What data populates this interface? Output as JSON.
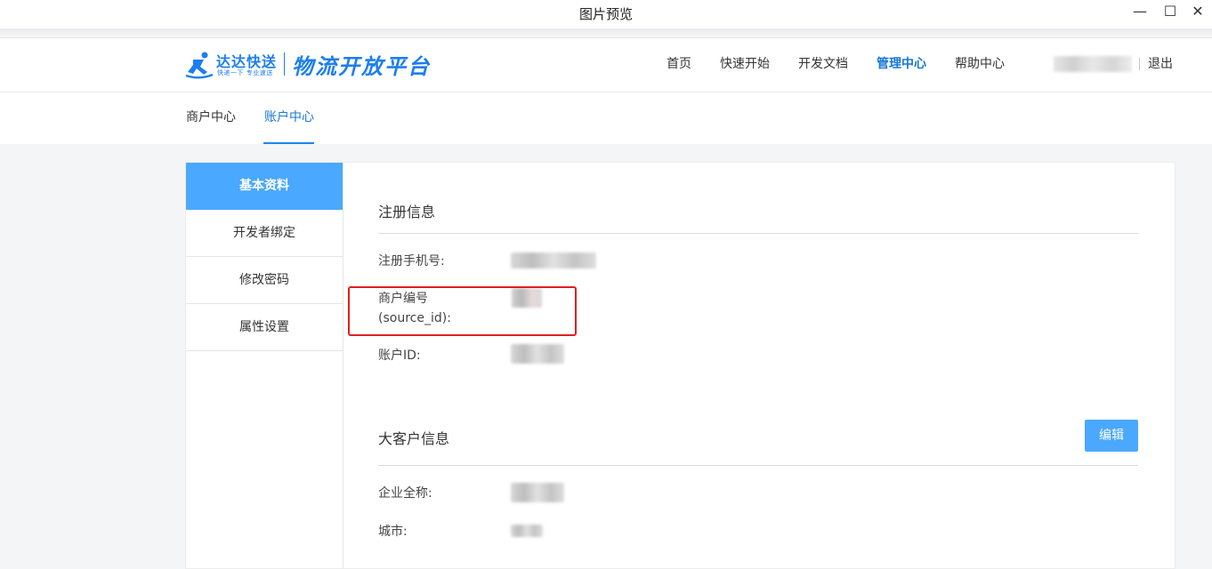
{
  "window": {
    "title": "图片预览",
    "controls": {
      "minimize": "—",
      "maximize": "☐",
      "close": "✕"
    }
  },
  "header": {
    "brand": "达达快送",
    "slogan": "快递一下 专业速送",
    "platform": "物流开放平台",
    "nav": [
      {
        "label": "首页"
      },
      {
        "label": "快速开始"
      },
      {
        "label": "开发文档"
      },
      {
        "label": "管理中心",
        "active": true
      },
      {
        "label": "帮助中心"
      }
    ],
    "logout": "退出"
  },
  "tabs": [
    {
      "label": "商户中心"
    },
    {
      "label": "账户中心",
      "active": true
    }
  ],
  "sidebar": {
    "items": [
      {
        "label": "基本资料",
        "active": true
      },
      {
        "label": "开发者绑定"
      },
      {
        "label": "修改密码"
      },
      {
        "label": "属性设置"
      }
    ]
  },
  "registration": {
    "title": "注册信息",
    "phone_label": "注册手机号:",
    "merchant_label_line1": "商户编号",
    "merchant_label_line2": "(source_id):",
    "account_label": "账户ID:"
  },
  "enterprise": {
    "title": "大客户信息",
    "edit_label": "编辑",
    "company_label": "企业全称:",
    "city_label": "城市:"
  },
  "colors": {
    "accent": "#1677d8",
    "sidebar_active": "#4ba8ff",
    "highlight_box": "#e02020"
  }
}
